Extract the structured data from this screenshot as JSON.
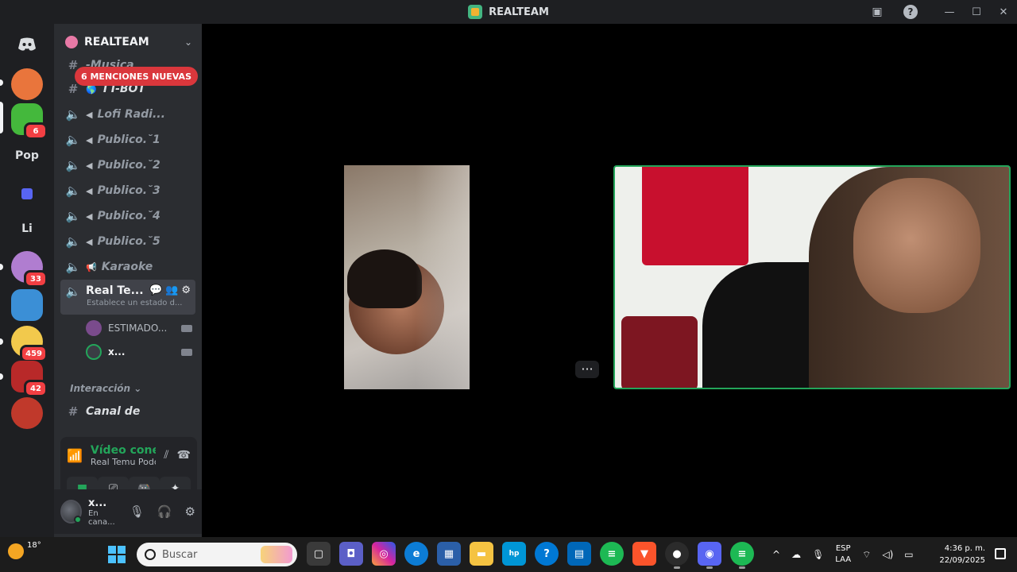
{
  "window": {
    "title": "REALTEAM"
  },
  "rail": {
    "items": [
      {
        "name": "discord-home-icon",
        "label": ""
      },
      {
        "name": "server-1",
        "label": "",
        "color": "#e9753c"
      },
      {
        "name": "server-2",
        "label": "",
        "color": "#44b83c",
        "badge": "6"
      },
      {
        "name": "server-pop",
        "label": "Pop"
      },
      {
        "name": "server-folder",
        "label": "",
        "color": "#5865f2"
      },
      {
        "name": "server-li",
        "label": "Li"
      },
      {
        "name": "server-3",
        "label": "",
        "color": "#b07dd0",
        "badge": "33"
      },
      {
        "name": "server-4",
        "label": "",
        "color": "#3b8fd6"
      },
      {
        "name": "server-5",
        "label": "",
        "color": "#f2c94c",
        "badge": "459"
      },
      {
        "name": "server-6",
        "label": "",
        "color": "#b82929",
        "badge": "42"
      }
    ]
  },
  "sidebar": {
    "server_name": "REALTEAM",
    "mentions_label": "6 MENCIONES NUEVAS",
    "channels": [
      {
        "label": "-Musica",
        "type": "text"
      },
      {
        "label": "TT-BOT",
        "type": "text"
      },
      {
        "label": "Lofi Radi...",
        "type": "voice"
      },
      {
        "label": "Publico.˘1",
        "type": "voice"
      },
      {
        "label": "Publico.˘2",
        "type": "voice"
      },
      {
        "label": "Publico.˘3",
        "type": "voice"
      },
      {
        "label": "Publico.˘4",
        "type": "voice"
      },
      {
        "label": "Publico.˘5",
        "type": "voice"
      },
      {
        "label": "Karaoke",
        "type": "voice"
      }
    ],
    "active_channel": {
      "label": "Real Te...",
      "status": "Establece un estado d..."
    },
    "voice_users": [
      {
        "label": "ESTIMADO...",
        "color": "#7a4b8c"
      },
      {
        "label": "x...",
        "color": "#3a3d44"
      }
    ],
    "category": "Interacción",
    "next_channel": "Canal de"
  },
  "voice_panel": {
    "title": "Vídeo conectado",
    "subtitle": "Real Temu Podcast ..."
  },
  "user": {
    "name": "x...",
    "status": "En cana..."
  },
  "taskbar": {
    "temperature": "18°",
    "search_placeholder": "Buscar",
    "language_top": "ESP",
    "language_bottom": "LAA",
    "time": "4:36 p. m.",
    "date": "22/09/2025"
  },
  "colors": {
    "accent_green": "#23a55a",
    "mention_red": "#da373c",
    "sidebar_bg": "#2b2d31",
    "rail_bg": "#1e1f22"
  }
}
